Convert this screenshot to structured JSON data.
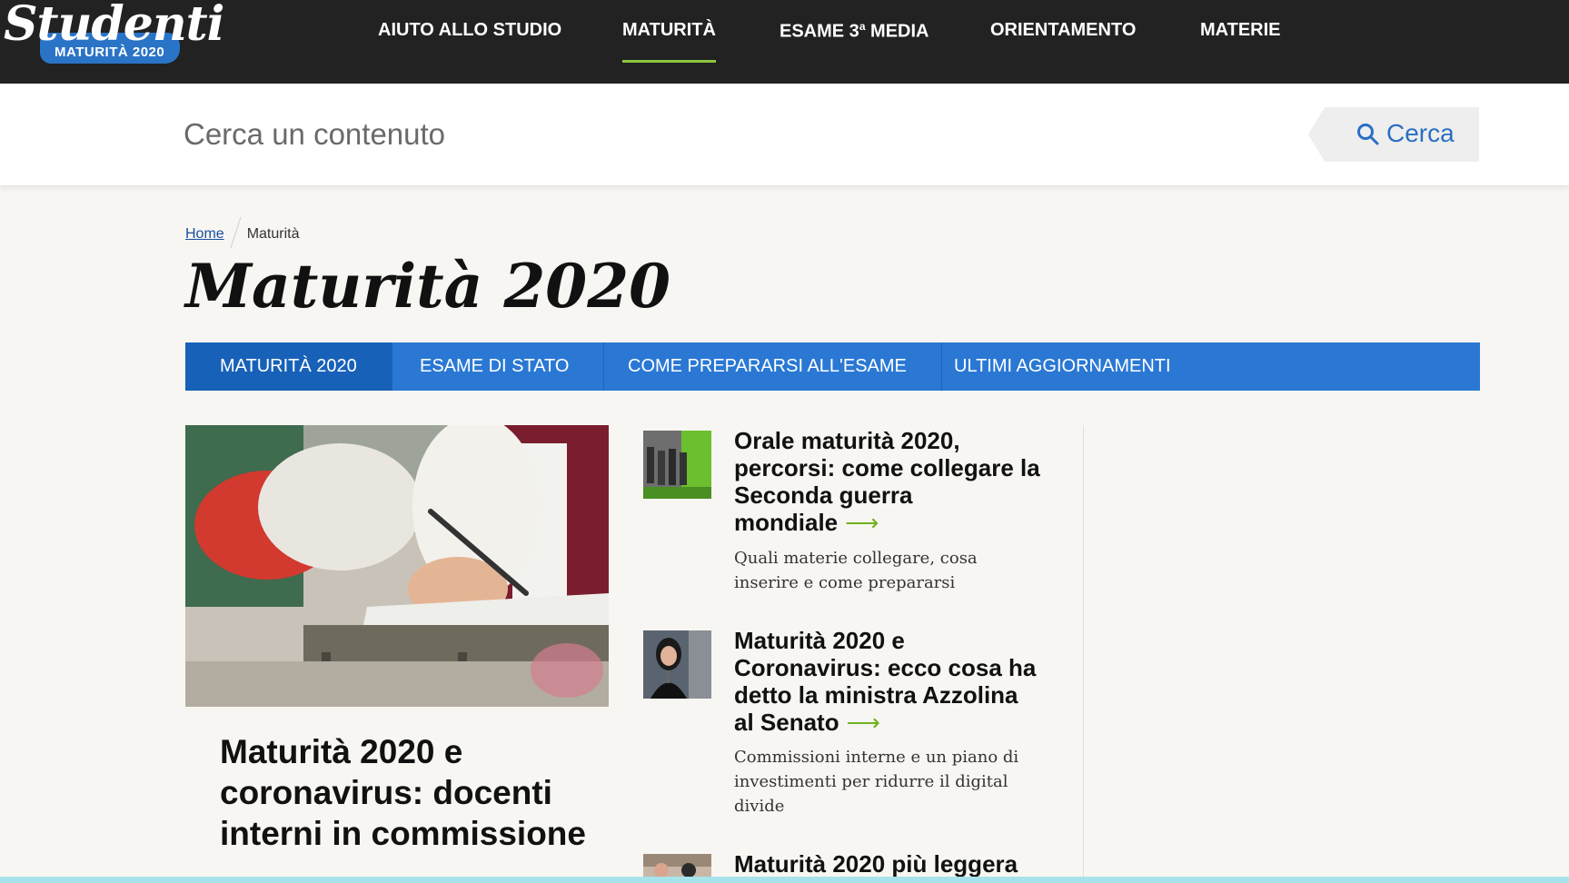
{
  "logo": {
    "word": "Studenti",
    "sub": "MATURITÀ 2020"
  },
  "nav": {
    "items": [
      {
        "label": "AIUTO ALLO STUDIO"
      },
      {
        "label": "MATURITÀ"
      },
      {
        "label": "ESAME 3",
        "sup": "a",
        "suffix": " MEDIA"
      },
      {
        "label": "ORIENTAMENTO"
      },
      {
        "label": "MATERIE"
      }
    ],
    "active": "MATURITÀ"
  },
  "search": {
    "placeholder": "Cerca un contenuto",
    "button_label": "Cerca"
  },
  "breadcrumb": {
    "home": "Home",
    "current": "Maturità"
  },
  "page_title": "Maturità 2020",
  "tabs": [
    {
      "label": "MATURITÀ 2020"
    },
    {
      "label": "ESAME DI STATO"
    },
    {
      "label": "COME PREPARARSI ALL'ESAME"
    },
    {
      "label": "ULTIMI AGGIORNAMENTI"
    }
  ],
  "feature": {
    "title": "Maturità 2020 e coronavirus: docenti interni in commissione"
  },
  "articles": [
    {
      "title": "Orale maturità 2020, percorsi: come collegare la Seconda guerra mondiale",
      "desc": "Quali materie collegare, cosa inserire e come prepararsi"
    },
    {
      "title": "Maturità 2020 e Coronavirus: ecco cosa ha detto la ministra Azzolina al Senato",
      "desc": "Commissioni interne e un piano di investimenti per ridurre il digital divide"
    },
    {
      "title": "Maturità 2020 più leggera",
      "desc": ""
    }
  ],
  "arrow_glyph": "⟶",
  "colors": {
    "topbar": "#222222",
    "accent_green": "#8cc63f",
    "tab_blue": "#2a78d4",
    "link_blue": "#2a6fc4"
  }
}
